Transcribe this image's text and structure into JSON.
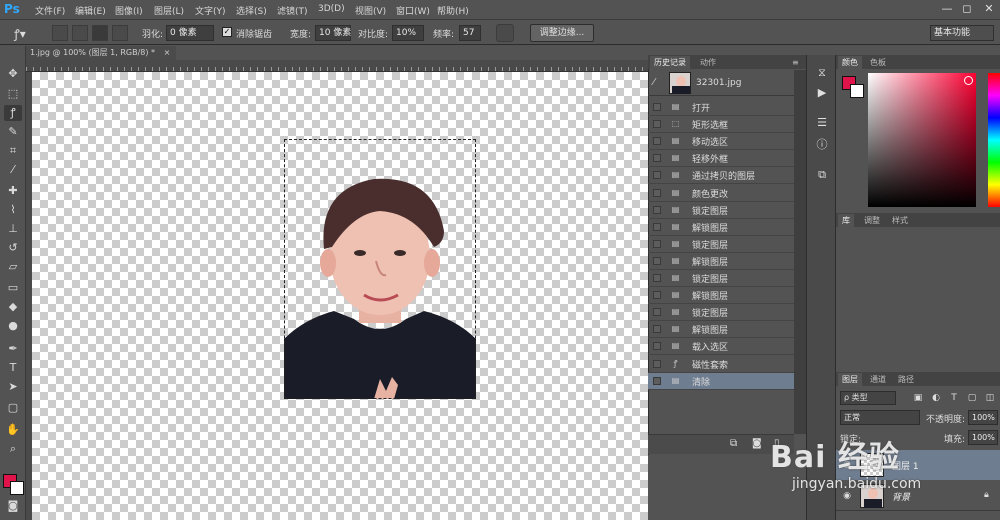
{
  "app": {
    "logo": "Ps"
  },
  "menubar": {
    "items": [
      "文件(F)",
      "编辑(E)",
      "图像(I)",
      "图层(L)",
      "文字(Y)",
      "选择(S)",
      "滤镜(T)",
      "3D(D)",
      "视图(V)",
      "窗口(W)",
      "帮助(H)"
    ],
    "window_controls": [
      "—",
      "◻",
      "✕"
    ]
  },
  "options": {
    "feather_label": "羽化:",
    "feather_value": "0 像素",
    "antialias_label": "消除锯齿",
    "width_label": "宽度:",
    "width_value": "10 像素",
    "contrast_label": "对比度:",
    "contrast_value": "10%",
    "frequency_label": "频率:",
    "frequency_value": "57",
    "refine_edge_button": "调整边缘...",
    "workspace": "基本功能"
  },
  "document": {
    "tab_title": "1.jpg @ 100% (图层 1, RGB/8) *",
    "tab_close": "×"
  },
  "history_panel": {
    "tabs": [
      "历史记录",
      "动作"
    ],
    "snapshot_name": "32301.jpg",
    "items": [
      {
        "label": "打开",
        "icon": "document-icon"
      },
      {
        "label": "矩形选框",
        "icon": "marquee-icon"
      },
      {
        "label": "移动选区",
        "icon": "document-icon"
      },
      {
        "label": "轻移外框",
        "icon": "document-icon"
      },
      {
        "label": "通过拷贝的图层",
        "icon": "document-icon"
      },
      {
        "label": "颜色更改",
        "icon": "document-icon"
      },
      {
        "label": "锁定图层",
        "icon": "document-icon"
      },
      {
        "label": "解锁图层",
        "icon": "document-icon"
      },
      {
        "label": "锁定图层",
        "icon": "document-icon"
      },
      {
        "label": "解锁图层",
        "icon": "document-icon"
      },
      {
        "label": "锁定图层",
        "icon": "document-icon"
      },
      {
        "label": "解锁图层",
        "icon": "document-icon"
      },
      {
        "label": "锁定图层",
        "icon": "document-icon"
      },
      {
        "label": "解锁图层",
        "icon": "document-icon"
      },
      {
        "label": "载入选区",
        "icon": "document-icon"
      },
      {
        "label": "磁性套索",
        "icon": "lasso-icon"
      },
      {
        "label": "清除",
        "icon": "document-icon"
      }
    ],
    "selected_index": 16
  },
  "color_panel": {
    "tabs": [
      "颜色",
      "色板"
    ],
    "foreground": "#e0144a",
    "background": "#ffffff"
  },
  "library_panel": {
    "tabs": [
      "库",
      "调整",
      "样式"
    ]
  },
  "layers_panel": {
    "tabs": [
      "图层",
      "通道",
      "路径"
    ],
    "filter_label": "ρ 类型",
    "blend_mode": "正常",
    "opacity_label": "不透明度:",
    "opacity_value": "100%",
    "lock_label": "锁定:",
    "fill_label": "填充:",
    "fill_value": "100%",
    "layers": [
      {
        "name": "图层 1",
        "selected": true
      },
      {
        "name": "背景",
        "selected": false
      }
    ]
  },
  "watermark": {
    "logo": "Bai 经验",
    "url": "jingyan.baidu.com"
  }
}
